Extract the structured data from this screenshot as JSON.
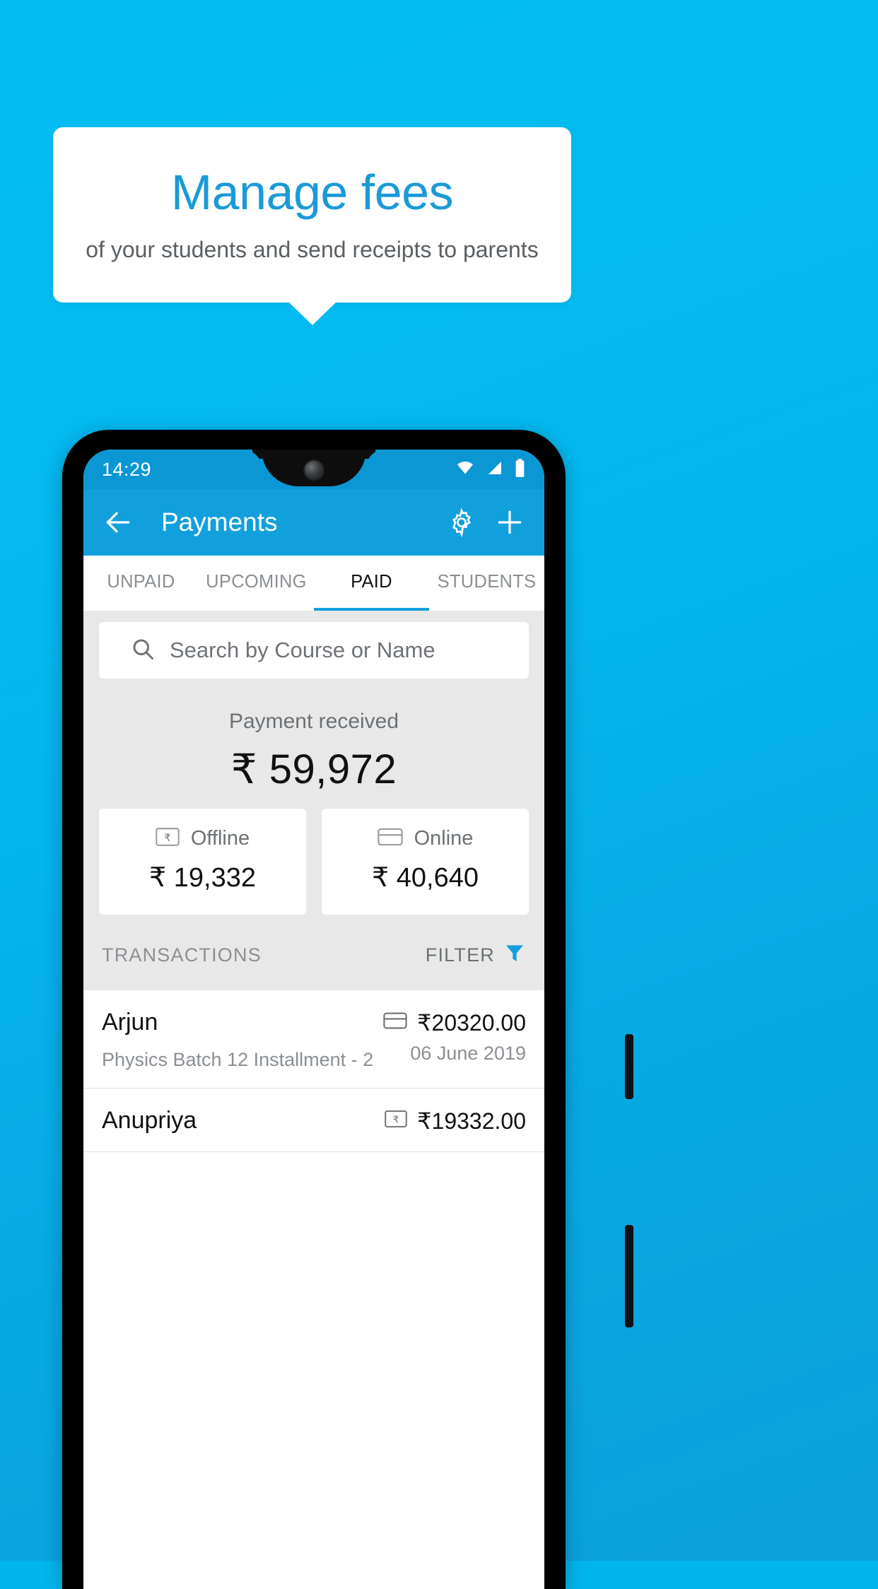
{
  "promo": {
    "title": "Manage fees",
    "subtitle": "of your students and send receipts to parents"
  },
  "colors": {
    "background": "#03bdf2",
    "accent": "#12a0dd",
    "statusbar": "#0b97d4",
    "card": "#ffffff",
    "body": "#e8e8e8"
  },
  "phone": {
    "statusbar": {
      "time": "14:29",
      "icons": [
        "wifi-icon",
        "signal-icon",
        "battery-icon"
      ]
    },
    "appbar": {
      "back_icon": "back-arrow-icon",
      "title": "Payments",
      "settings_icon": "gear-icon",
      "add_icon": "plus-icon"
    },
    "tabs": [
      {
        "label": "UNPAID",
        "active": false
      },
      {
        "label": "UPCOMING",
        "active": false
      },
      {
        "label": "PAID",
        "active": true
      },
      {
        "label": "STUDENTS",
        "active": false
      }
    ],
    "search": {
      "icon": "search-icon",
      "placeholder": "Search by Course or Name",
      "value": ""
    },
    "summary": {
      "label": "Payment received",
      "amount": "₹ 59,972",
      "cards": [
        {
          "icon": "rupee-note-icon",
          "label": "Offline",
          "amount": "₹ 19,332"
        },
        {
          "icon": "credit-card-icon",
          "label": "Online",
          "amount": "₹ 40,640"
        }
      ]
    },
    "transactions_header": {
      "title": "TRANSACTIONS",
      "filter_label": "FILTER",
      "filter_icon": "funnel-icon"
    },
    "transactions": [
      {
        "name": "Arjun",
        "subtitle": "Physics Batch 12 Installment - 2",
        "amount": "₹20320.00",
        "date": "06 June 2019",
        "method_icon": "credit-card-icon"
      },
      {
        "name": "Anupriya",
        "subtitle": "",
        "amount": "₹19332.00",
        "date": "",
        "method_icon": "rupee-note-icon"
      }
    ]
  }
}
